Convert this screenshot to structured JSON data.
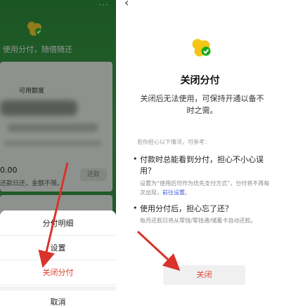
{
  "left": {
    "tagline": "使用分付，随借随还",
    "card_label": "可用额度",
    "amount": "0.00",
    "hint": "还款日还，金额不限。",
    "repay_button": "还款",
    "menu": [
      {
        "label": "分付明细"
      },
      {
        "label": "设置"
      },
      {
        "label": "关闭分付"
      },
      {
        "label": "取消"
      }
    ]
  },
  "right": {
    "title": "关闭分付",
    "description": "关闭后无法使用，可保持开通以备不时之需。",
    "if_text": "若你担心以下情况，可参考：",
    "q1": "付款时总能看到分付，担心不小心误用？",
    "a1_prefix": "设置为“使用后可作为优先支付方式”，分付将不再每次出现，",
    "a1_link": "前往设置",
    "a1_suffix": "。",
    "q2": "使用分付后，担心忘了还？",
    "a2": "每月还款日将从零钱/零钱通/储蓄卡自动还款。",
    "close_button": "关闭"
  },
  "colors": {
    "brand_green": "#2b8a3a",
    "logo_yellow": "#f5c518",
    "logo_green": "#1aad19",
    "danger_red": "#e03a2b",
    "link_blue": "#3b5bd6",
    "arrow_red": "#d9332b"
  },
  "icons": [
    "back-arrow-icon",
    "more-icon",
    "fenfu-logo-icon",
    "checkmark-icon"
  ]
}
